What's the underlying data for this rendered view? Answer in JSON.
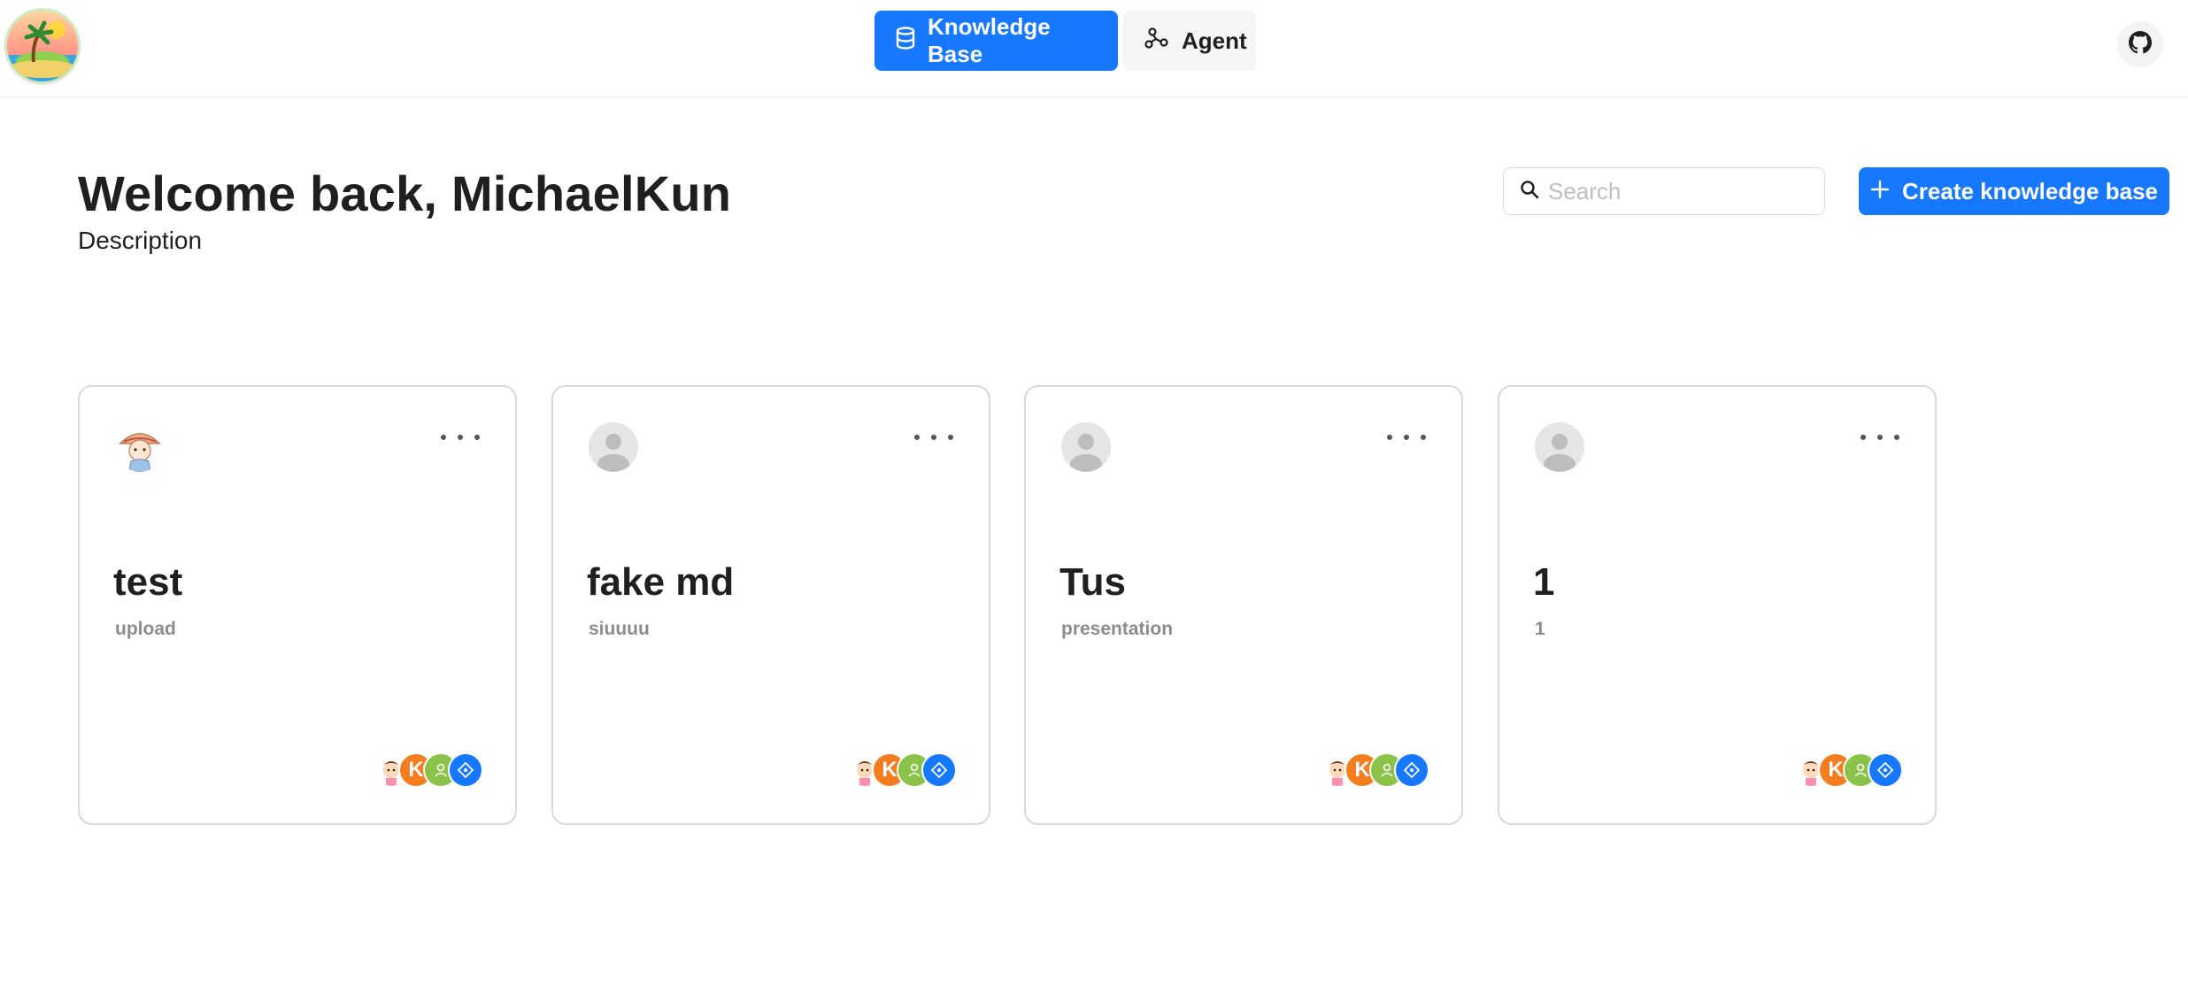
{
  "header": {
    "nav": [
      {
        "label": "Knowledge Base",
        "icon": "database-icon",
        "active": true
      },
      {
        "label": "Agent",
        "icon": "graph-icon",
        "active": false
      }
    ],
    "github_icon": "github-icon"
  },
  "main": {
    "welcome": "Welcome back, MichaelKun",
    "description": "Description",
    "search": {
      "placeholder": "Search",
      "value": ""
    },
    "create_label": "Create knowledge base"
  },
  "cards": [
    {
      "title": "test",
      "subtitle": "upload",
      "avatar": "girl-avatar"
    },
    {
      "title": "fake md",
      "subtitle": "siuuuu",
      "avatar": "default-avatar"
    },
    {
      "title": "Tus",
      "subtitle": "presentation",
      "avatar": "default-avatar"
    },
    {
      "title": "1",
      "subtitle": "1",
      "avatar": "default-avatar"
    }
  ],
  "tool_badges": {
    "k_letter": "K"
  },
  "colors": {
    "primary": "#1677ff",
    "orange": "#f57c1f",
    "green": "#8bc34a"
  }
}
